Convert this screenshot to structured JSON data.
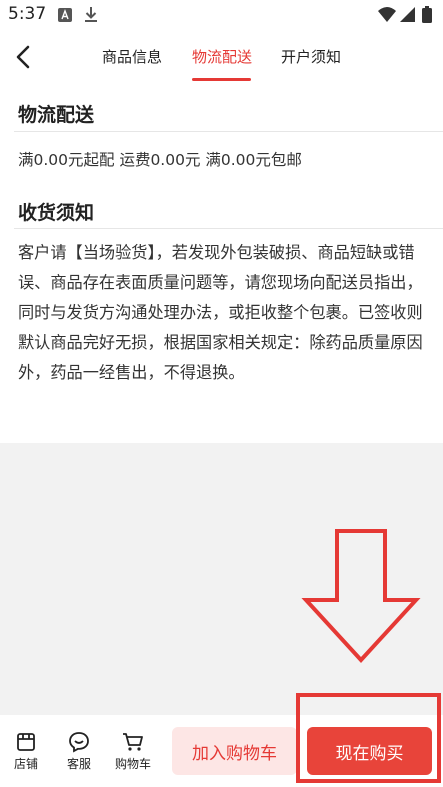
{
  "status_bar": {
    "time": "5:37"
  },
  "header": {
    "tabs": [
      {
        "label": "商品信息",
        "active": false
      },
      {
        "label": "物流配送",
        "active": true
      },
      {
        "label": "开户须知",
        "active": false
      }
    ]
  },
  "shipping": {
    "title": "物流配送",
    "info": "满0.00元起配 运费0.00元 满0.00元包邮"
  },
  "receiving": {
    "title": "收货须知",
    "text": "客户请【当场验货】，若发现外包装破损、商品短缺或错误、商品存在表面质量问题等，请您现场向配送员指出，同时与发货方沟通处理办法，或拒收整个包裹。已签收则默认商品完好无损，根据国家相关规定：除药品质量原因外，药品一经售出，不得退换。"
  },
  "bottom_bar": {
    "store_label": "店铺",
    "service_label": "客服",
    "cart_label": "购物车",
    "add_to_cart_label": "加入购物车",
    "buy_now_label": "现在购买"
  },
  "colors": {
    "accent": "#e53935",
    "buy_button": "#e8443a",
    "cart_button_bg": "#fde6e5"
  },
  "icons": [
    "back-arrow-icon",
    "store-icon",
    "customer-service-icon",
    "cart-icon",
    "wifi-icon",
    "signal-icon",
    "battery-icon",
    "download-icon",
    "app-notification-icon"
  ]
}
